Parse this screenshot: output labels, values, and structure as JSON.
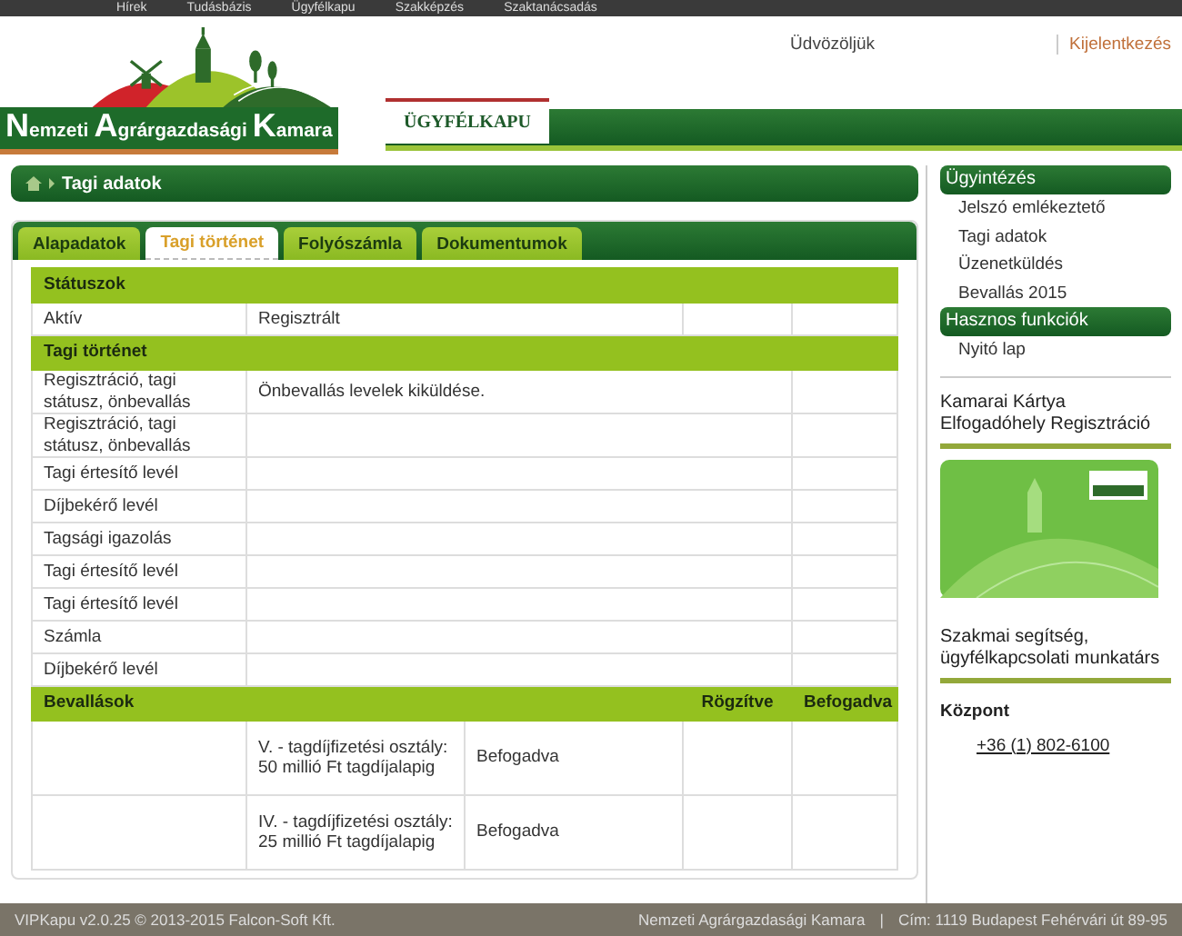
{
  "top_nav": [
    "Hírek",
    "Tudásbázis",
    "Ügyfélkapu",
    "Szakképzés",
    "Szaktanácsadás"
  ],
  "header": {
    "logo_words": [
      "Nemzeti",
      "Agrárgazdasági",
      "Kamara"
    ],
    "welcome": "Üdvözöljük",
    "logout": "Kijelentkezés",
    "portal_tab": "ÜGYFÉLKAPU"
  },
  "breadcrumb": {
    "current": "Tagi adatok"
  },
  "tabs": [
    {
      "label": "Alapadatok",
      "selected": false
    },
    {
      "label": "Tagi történet",
      "selected": true
    },
    {
      "label": "Folyószámla",
      "selected": false
    },
    {
      "label": "Dokumentumok",
      "selected": false
    }
  ],
  "table": {
    "sections": [
      {
        "kind": "status",
        "title": "Státuszok",
        "rows": [
          {
            "label": "Aktív",
            "value": "Regisztrált"
          }
        ]
      },
      {
        "kind": "history",
        "title": "Tagi történet",
        "rows": [
          {
            "label": "Regisztráció, tagi státusz, önbevallás",
            "description": "Önbevallás levelek kiküldése."
          },
          {
            "label": "Regisztráció, tagi státusz, önbevallás"
          },
          {
            "label": "Tagi értesítő levél"
          },
          {
            "label": "Díjbekérő levél"
          },
          {
            "label": "Tagsági igazolás"
          },
          {
            "label": "Tagi értesítő levél"
          },
          {
            "label": "Tagi értesítő levél"
          },
          {
            "label": "Számla"
          },
          {
            "label": "Díjbekérő levél"
          }
        ]
      },
      {
        "kind": "declarations",
        "title": "Bevallások",
        "column_4": "Rögzítve",
        "column_5": "Befogadva",
        "rows": [
          {
            "class": "V. - tagdíjfizetési osztály: 50 millió Ft tagdíjalapig",
            "status": "Befogadva"
          },
          {
            "class": "IV. - tagdíjfizetési osztály: 25 millió Ft tagdíjalapig",
            "status": "Befogadva"
          }
        ]
      }
    ]
  },
  "sidebar": {
    "sections": [
      {
        "title": "Ügyintézés",
        "items": [
          "Jelszó emlékeztető",
          "Tagi adatok",
          "Üzenetküldés",
          "Bevallás 2015"
        ]
      },
      {
        "title": "Hasznos funkciók",
        "items": [
          "Nyitó lap"
        ]
      }
    ],
    "promo": "Kamarai Kártya Elfogadóhely Regisztráció",
    "help": "Szakmai segítség, ügyfélkapcsolati munkatárs",
    "contact_label": "Központ",
    "phone": "+36 (1) 802-6100"
  },
  "footer": {
    "left": "VIPKapu v2.0.25 © 2013-2015 Falcon-Soft Kft.",
    "right": [
      "Nemzeti Agrárgazdasági Kamara",
      "|",
      "Cím: 1119 Budapest Fehérvári út 89-95"
    ]
  }
}
